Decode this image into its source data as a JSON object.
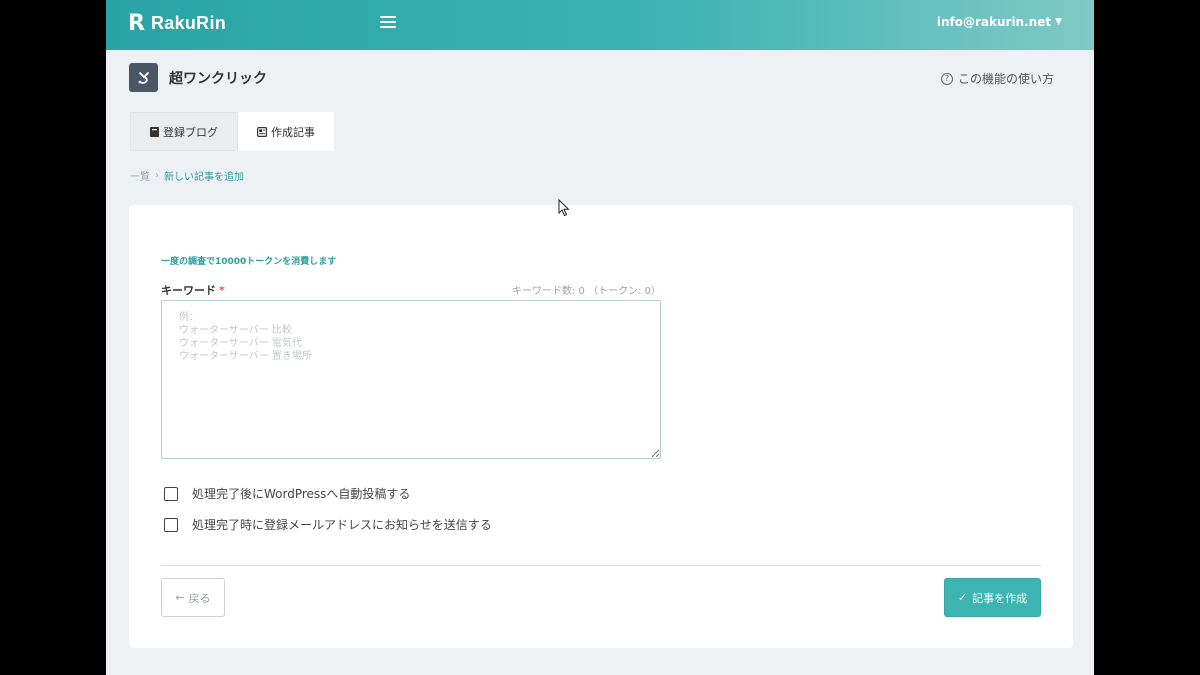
{
  "header": {
    "logo_mark": "R",
    "logo_text": "RakuRin",
    "user_email": "info@rakurin.net"
  },
  "page": {
    "title": "超ワンクリック",
    "help_link": "この機能の使い方"
  },
  "tabs": [
    {
      "label": "登録ブログ"
    },
    {
      "label": "作成記事"
    }
  ],
  "breadcrumb": {
    "prev": "一覧",
    "current": "新しい記事を追加"
  },
  "form": {
    "token_note": "一度の調査で10000トークンを消費します",
    "keyword_label": "キーワード",
    "required_mark": "*",
    "keyword_count": "キーワード数: 0 （トークン: 0）",
    "keyword_value": "",
    "keyword_placeholder": "例：\nウォーターサーバー 比較\nウォーターサーバー 電気代\nウォーターサーバー 置き場所",
    "checkboxes": [
      {
        "label": "処理完了後にWordPressへ自動投稿する",
        "checked": false
      },
      {
        "label": "処理完了時に登録メールアドレスにお知らせを送信する",
        "checked": false
      }
    ],
    "back_label": "戻る",
    "create_label": "記事を作成"
  },
  "colors": {
    "accent": "#3cb4b2",
    "accent_text": "#2e9ea0",
    "required": "#e05a5a"
  },
  "icons": {
    "menu": "hamburger-icon",
    "user_dropdown": "chevron-down-icon",
    "help": "question-circle-icon",
    "tab_blog": "book-icon",
    "tab_articles": "newspaper-icon",
    "back": "arrow-left-icon",
    "create": "check-icon"
  }
}
